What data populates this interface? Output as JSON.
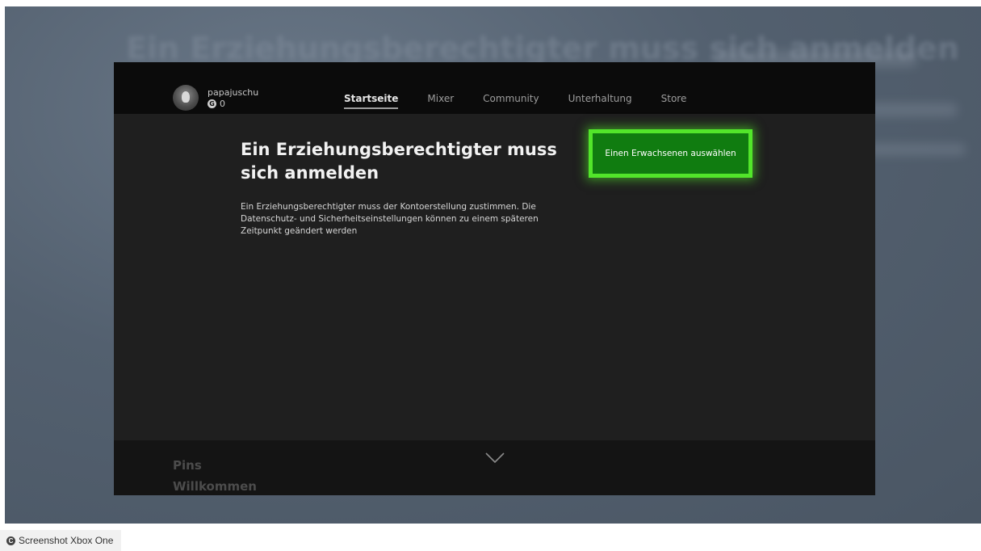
{
  "background": {
    "ghost_title": "Ein Erziehungsberechtigter muss sich anmelden"
  },
  "profile": {
    "gamertag": "papajuschu",
    "gamerscore": "0"
  },
  "nav": {
    "tabs": [
      {
        "label": "Startseite",
        "active": true
      },
      {
        "label": "Mixer",
        "active": false
      },
      {
        "label": "Community",
        "active": false
      },
      {
        "label": "Unterhaltung",
        "active": false
      },
      {
        "label": "Store",
        "active": false
      }
    ]
  },
  "dialog": {
    "heading": "Ein Erziehungsberechtigter muss sich anmelden",
    "body": "Ein Erziehungsberechtigter muss der Kontoerstellung zustimmen. Die Datenschutz- und Sicherheitseinstellungen können zu einem späteren Zeitpunkt geändert werden",
    "button_label": "Einen Erwachsenen auswählen"
  },
  "bottom": {
    "pins_label": "Pins",
    "welcome_label": "Willkommen"
  },
  "caption": {
    "icon_letter": "C",
    "text": "Screenshot Xbox One"
  },
  "colors": {
    "accent_green": "#107c10",
    "focus_glow": "#52e62a"
  }
}
